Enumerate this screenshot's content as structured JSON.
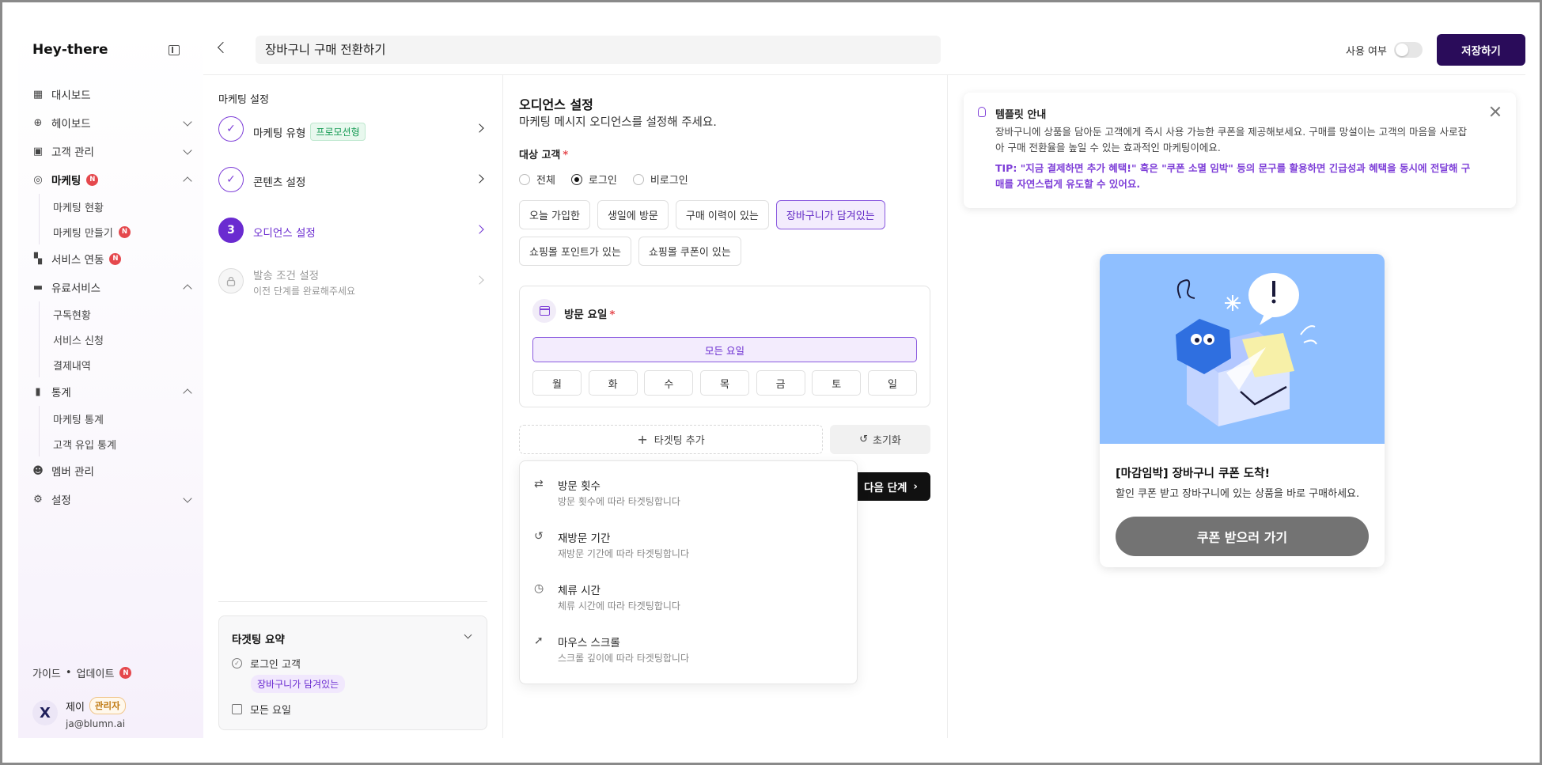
{
  "sidebar": {
    "brand": "Hey-there",
    "items": [
      {
        "label": "대시보드",
        "icon": "dashboard-icon"
      },
      {
        "label": "헤이보드",
        "icon": "plus-circle-icon"
      },
      {
        "label": "고객 관리",
        "icon": "customer-icon"
      },
      {
        "label": "마케팅",
        "icon": "target-icon",
        "badge": "N",
        "sub": [
          {
            "label": "마케팅 현황"
          },
          {
            "label": "마케팅 만들기",
            "badge": "N"
          }
        ]
      },
      {
        "label": "서비스 연동",
        "icon": "apps-icon",
        "badge": "N"
      },
      {
        "label": "유료서비스",
        "icon": "card-icon",
        "sub": [
          {
            "label": "구독현황"
          },
          {
            "label": "서비스 신청"
          },
          {
            "label": "결제내역"
          }
        ]
      },
      {
        "label": "통계",
        "icon": "chart-icon",
        "sub": [
          {
            "label": "마케팅 통계"
          },
          {
            "label": "고객 유입 통계"
          }
        ]
      },
      {
        "label": "멤버 관리",
        "icon": "member-icon"
      },
      {
        "label": "설정",
        "icon": "gear-icon"
      }
    ],
    "guide": {
      "a": "가이드",
      "sep": "•",
      "b": "업데이트",
      "badge": "N"
    },
    "user": {
      "name": "제이",
      "role": "관리자",
      "email": "ja@blumn.ai",
      "avatar": "X"
    }
  },
  "topbar": {
    "title": "장바구니 구매 전환하기",
    "use_label": "사용 여부",
    "save_label": "저장하기"
  },
  "steps": {
    "title": "마케팅 설정",
    "items": [
      {
        "num": "✓",
        "label": "마케팅 유형",
        "tag": "프로모션형"
      },
      {
        "num": "✓",
        "label": "콘텐츠 설정"
      },
      {
        "num": "3",
        "label": "오디언스 설정"
      },
      {
        "num": "",
        "label": "발송 조건 설정",
        "sub": "이전 단계를 완료해주세요"
      }
    ],
    "summary": {
      "title": "타겟팅 요약",
      "row1": "로그인 고객",
      "tag": "장바구니가 담겨있는",
      "row2": "모든 요일"
    }
  },
  "audience": {
    "title": "오디언스 설정",
    "desc": "마케팅 메시지 오디언스를 설정해 주세요.",
    "target_label": "대상 고객",
    "required": "*",
    "radios": [
      "전체",
      "로그인",
      "비로그인"
    ],
    "chips": [
      "오늘 가입한",
      "생일에 방문",
      "구매 이력이 있는",
      "장바구니가 담겨있는",
      "쇼핑몰 포인트가 있는",
      "쇼핑몰 쿠폰이 있는"
    ],
    "day_title": "방문 요일",
    "all_days": "모든 요일",
    "days": [
      "월",
      "화",
      "수",
      "목",
      "금",
      "토",
      "일"
    ],
    "add_target": "타겟팅 추가",
    "reset": "초기화",
    "next": "다음 단계",
    "dropdown": [
      {
        "title": "방문 횟수",
        "desc": "방문 횟수에 따라 타겟팅합니다"
      },
      {
        "title": "재방문 기간",
        "desc": "재방문 기간에 따라 타겟팅합니다"
      },
      {
        "title": "체류 시간",
        "desc": "체류 시간에 따라 타겟팅합니다"
      },
      {
        "title": "마우스 스크롤",
        "desc": "스크롤 깊이에 따라 타겟팅합니다"
      }
    ]
  },
  "preview": {
    "tip_title": "템플릿 안내",
    "tip_body": "장바구니에 상품을 담아둔 고객에게 즉시 사용 가능한 쿠폰을 제공해보세요. 구매를 망설이는 고객의 마음을 사로잡아 구매 전환율을 높일 수 있는 효과적인 마케팅이에요.",
    "tip_tip": "TIP: \"지금 결제하면 추가 혜택!\" 혹은 \"쿠폰 소멸 임박\" 등의 문구를 활용하면 긴급성과 혜택을 동시에 전달해 구매를 자연스럽게 유도할 수 있어요.",
    "card_title": "[마감임박] 장바구니 쿠폰 도착!",
    "card_desc": "할인 쿠폰 받고 장바구니에 있는 상품을 바로 구매하세요.",
    "card_button": "쿠폰 받으러 가기"
  }
}
